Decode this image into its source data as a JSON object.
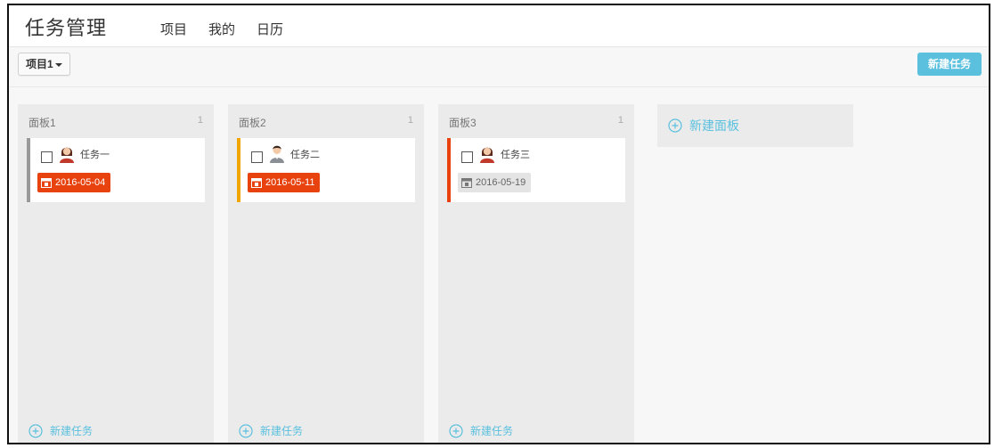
{
  "app": {
    "title": "任务管理"
  },
  "nav": [
    {
      "label": "项目"
    },
    {
      "label": "我的"
    },
    {
      "label": "日历"
    }
  ],
  "toolbar": {
    "project_select": "项目1",
    "new_task_button": "新建任务"
  },
  "boards": [
    {
      "title": "面板1",
      "count": "1",
      "add_task_label": "新建任务",
      "cards": [
        {
          "name": "任务一",
          "avatar": "female-avatar-icon",
          "date": "2016-05-04",
          "stripe_color": "#999999",
          "date_bg": "#e8430e",
          "date_fg": "#ffffff"
        }
      ]
    },
    {
      "title": "面板2",
      "count": "1",
      "add_task_label": "新建任务",
      "cards": [
        {
          "name": "任务二",
          "avatar": "male-avatar-icon",
          "date": "2016-05-11",
          "stripe_color": "#f0a500",
          "date_bg": "#e8430e",
          "date_fg": "#ffffff"
        }
      ]
    },
    {
      "title": "面板3",
      "count": "1",
      "add_task_label": "新建任务",
      "cards": [
        {
          "name": "任务三",
          "avatar": "female-avatar-icon",
          "date": "2016-05-19",
          "stripe_color": "#e8430e",
          "date_bg": "#e4e4e4",
          "date_fg": "#666666"
        }
      ]
    }
  ],
  "new_board": {
    "label": "新建面板"
  },
  "colors": {
    "accent": "#5bc0de",
    "overdue": "#e8430e",
    "warning": "#f0a500"
  }
}
